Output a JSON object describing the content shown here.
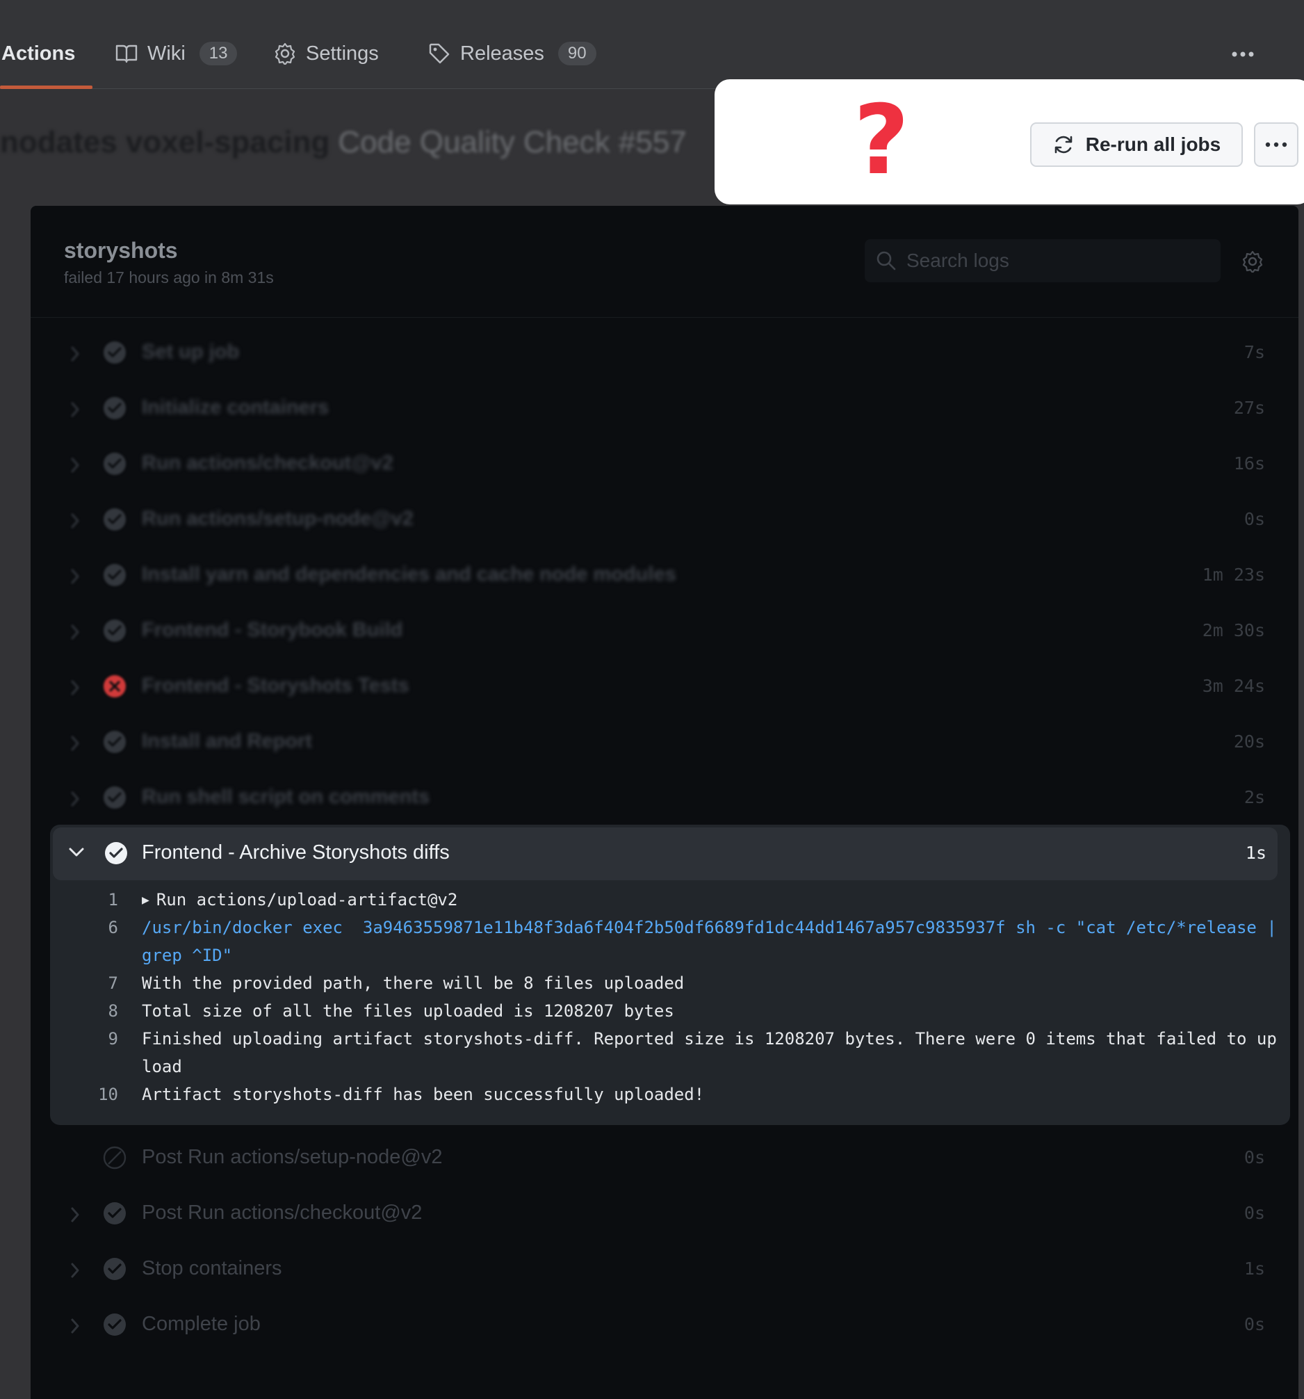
{
  "nav": {
    "actions_label": "Actions",
    "wiki_label": "Wiki",
    "wiki_count": "13",
    "settings_label": "Settings",
    "releases_label": "Releases",
    "releases_count": "90"
  },
  "run_title": {
    "text": "nodates voxel-spacing",
    "workflow": "Code Quality Check #557"
  },
  "popup": {
    "marker": "?",
    "rerun_label": "Re-run all jobs"
  },
  "job": {
    "name": "storyshots",
    "meta": "failed 17 hours ago in 8m 31s",
    "search_placeholder": "Search logs"
  },
  "steps_before": [
    {
      "name": "Set up job",
      "duration": "7s",
      "status": "success"
    },
    {
      "name": "Initialize containers",
      "duration": "27s",
      "status": "success"
    },
    {
      "name": "Run actions/checkout@v2",
      "duration": "16s",
      "status": "success"
    },
    {
      "name": "Run actions/setup-node@v2",
      "duration": "0s",
      "status": "success"
    },
    {
      "name": "Install yarn and dependencies and cache node modules",
      "duration": "1m 23s",
      "status": "success"
    },
    {
      "name": "Frontend - Storybook Build",
      "duration": "2m 30s",
      "status": "success"
    },
    {
      "name": "Frontend - Storyshots Tests",
      "duration": "3m 24s",
      "status": "failure"
    },
    {
      "name": "Install and Report",
      "duration": "20s",
      "status": "success"
    },
    {
      "name": "Run shell script on comments",
      "duration": "2s",
      "status": "success"
    }
  ],
  "expanded_step": {
    "name": "Frontend - Archive Storyshots diffs",
    "duration": "1s",
    "lines": [
      {
        "num": "1",
        "text": "Run actions/upload-artifact@v2"
      },
      {
        "num": "6",
        "text": "/usr/bin/docker exec  3a9463559871e11b48f3da6f404f2b50df6689fd1dc44dd1467a957c9835937f sh -c \"cat /etc/*release | grep ^ID\""
      },
      {
        "num": "7",
        "text": "With the provided path, there will be 8 files uploaded"
      },
      {
        "num": "8",
        "text": "Total size of all the files uploaded is 1208207 bytes"
      },
      {
        "num": "9",
        "text": "Finished uploading artifact storyshots-diff. Reported size is 1208207 bytes. There were 0 items that failed to upload"
      },
      {
        "num": "10",
        "text": "Artifact storyshots-diff has been successfully uploaded!"
      }
    ]
  },
  "steps_after": [
    {
      "name": "Post Run actions/setup-node@v2",
      "duration": "0s",
      "status": "skipped"
    },
    {
      "name": "Post Run actions/checkout@v2",
      "duration": "0s",
      "status": "success"
    },
    {
      "name": "Stop containers",
      "duration": "1s",
      "status": "success"
    },
    {
      "name": "Complete job",
      "duration": "0s",
      "status": "success"
    }
  ],
  "colors": {
    "accent_underline": "#c45b3b",
    "failure": "#d13a3a",
    "command_blue": "#56a8f5",
    "question_mark": "#ee3140"
  }
}
